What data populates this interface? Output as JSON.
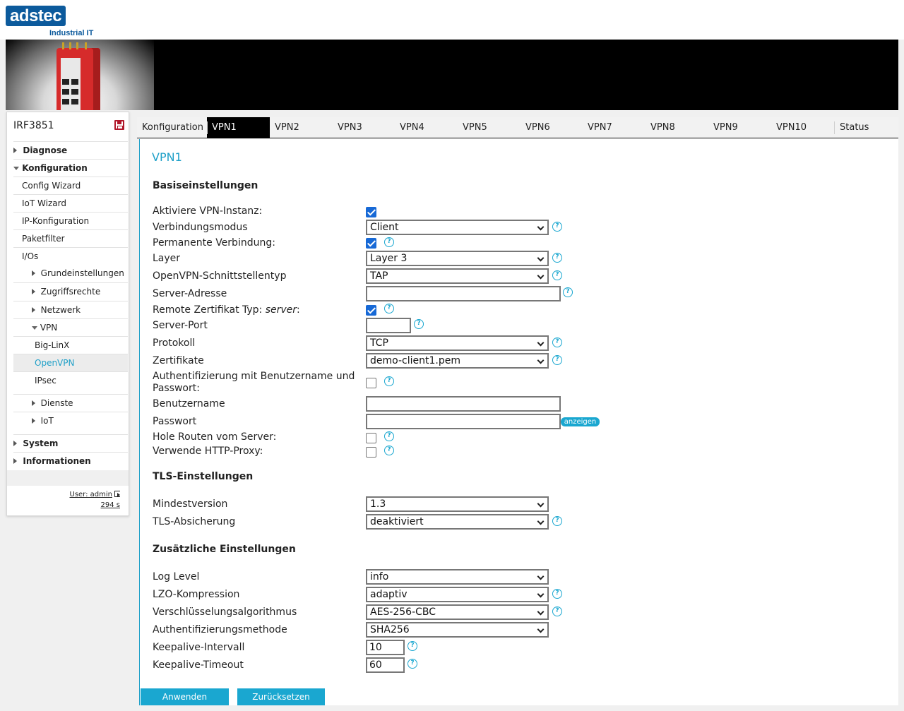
{
  "brand": {
    "logo_text": "adstec",
    "tagline": "Industrial IT"
  },
  "sidebar": {
    "device_name": "IRF3851",
    "items": [
      {
        "label": "Diagnose"
      },
      {
        "label": "Konfiguration"
      },
      {
        "label": "Config Wizard"
      },
      {
        "label": "IoT Wizard"
      },
      {
        "label": "IP-Konfiguration"
      },
      {
        "label": "Paketfilter"
      },
      {
        "label": "I/Os"
      },
      {
        "label": "Grundeinstellungen"
      },
      {
        "label": "Zugriffsrechte"
      },
      {
        "label": "Netzwerk"
      },
      {
        "label": "VPN"
      },
      {
        "label": "Big-LinX"
      },
      {
        "label": "OpenVPN"
      },
      {
        "label": "IPsec"
      },
      {
        "label": "Dienste"
      },
      {
        "label": "IoT"
      },
      {
        "label": "System"
      },
      {
        "label": "Informationen"
      }
    ],
    "user": "User: admin",
    "session_timer": "294 s"
  },
  "tabs": [
    "Konfiguration",
    "VPN1",
    "VPN2",
    "VPN3",
    "VPN4",
    "VPN5",
    "VPN6",
    "VPN7",
    "VPN8",
    "VPN9",
    "VPN10",
    "Status"
  ],
  "page": {
    "title": "VPN1",
    "sections": {
      "basic": "Basiseinstellungen",
      "tls": "TLS-Einstellungen",
      "extra": "Zusätzliche Einstellungen"
    },
    "fields": {
      "activate": {
        "label": "Aktiviere VPN-Instanz:",
        "checked": true
      },
      "mode": {
        "label": "Verbindungsmodus",
        "value": "Client"
      },
      "permanent": {
        "label": "Permanente Verbindung:",
        "checked": true
      },
      "layer": {
        "label": "Layer",
        "value": "Layer 3"
      },
      "iftype": {
        "label": "OpenVPN-Schnittstellentyp",
        "value": "TAP"
      },
      "server_addr": {
        "label": "Server-Adresse",
        "value": ""
      },
      "remote_cert_prefix": "Remote Zertifikat Typ: ",
      "remote_cert_em": "server",
      "remote_cert_suffix": ":",
      "server_port": {
        "label": "Server-Port",
        "value": ""
      },
      "protocol": {
        "label": "Protokoll",
        "value": "TCP"
      },
      "cert": {
        "label": "Zertifikate",
        "value": "demo-client1.pem"
      },
      "auth_user": {
        "label": "Authentifizierung mit Benutzername und Passwort:",
        "checked": false
      },
      "username": {
        "label": "Benutzername",
        "value": ""
      },
      "password": {
        "label": "Passwort",
        "value": "",
        "show_label": "anzeigen"
      },
      "routes": {
        "label": "Hole Routen vom Server:",
        "checked": false
      },
      "http_proxy": {
        "label": "Verwende HTTP-Proxy:",
        "checked": false
      },
      "min_version": {
        "label": "Mindestversion",
        "value": "1.3"
      },
      "tls_auth": {
        "label": "TLS-Absicherung",
        "value": "deaktiviert"
      },
      "log_level": {
        "label": "Log Level",
        "value": "info"
      },
      "lzo": {
        "label": "LZO-Kompression",
        "value": "adaptiv"
      },
      "cipher": {
        "label": "Verschlüsselungsalgorithmus",
        "value": "AES-256-CBC"
      },
      "auth_method": {
        "label": "Authentifizierungsmethode",
        "value": "SHA256"
      },
      "keepalive_interval": {
        "label": "Keepalive-Intervall",
        "value": "10"
      },
      "keepalive_timeout": {
        "label": "Keepalive-Timeout",
        "value": "60"
      }
    },
    "buttons": {
      "apply": "Anwenden",
      "reset": "Zurücksetzen"
    },
    "help_glyph": "?"
  },
  "colors": {
    "accent": "#1aa7d0",
    "brand": "#0c5a9c",
    "checkbox": "#1769d6"
  }
}
